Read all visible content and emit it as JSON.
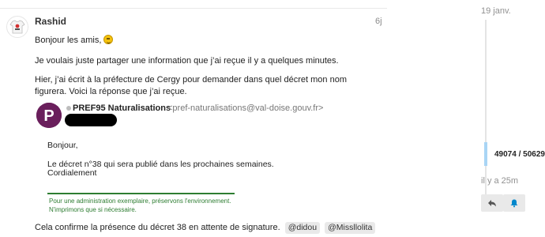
{
  "post": {
    "username": "Rashid",
    "age": "6j",
    "greeting": "Bonjour les amis,",
    "para1": "Je voulais juste partager une information que j’ai reçue il y a quelques minutes.",
    "para2": "Hier, j’ai écrit à la préfecture de Cergy pour demander dans quel décret mon nom figurera. Voici la réponse que j’ai reçue.",
    "conclusion": "Cela confirme la présence du décret 38 en attente de signature.",
    "mentions": [
      "@didou",
      "@Missllolita"
    ]
  },
  "quoted_email": {
    "logo_letter": "P",
    "sender_name": "PREF95 Naturalisations",
    "sender_email": "<pref-naturalisations@val-doise.gouv.fr>",
    "line1": "Bonjour,",
    "line2": "Le décret n°38 qui sera publié dans les prochaines semaines.",
    "line3": "Cordialement",
    "signature1": "Pour une administration exemplaire, préservons l'environnement.",
    "signature2": "N'imprimons que si nécessaire."
  },
  "timeline": {
    "start_date": "19 janv.",
    "progress": "49074 / 50629",
    "last_activity": "il y a 25m"
  },
  "buttons": {
    "reply_icon": "reply-icon",
    "bell_icon": "bell-icon"
  },
  "colors": {
    "accent": "#0088cc",
    "signature_green": "#2e7d32",
    "logo_purple": "#6a1f5c"
  }
}
